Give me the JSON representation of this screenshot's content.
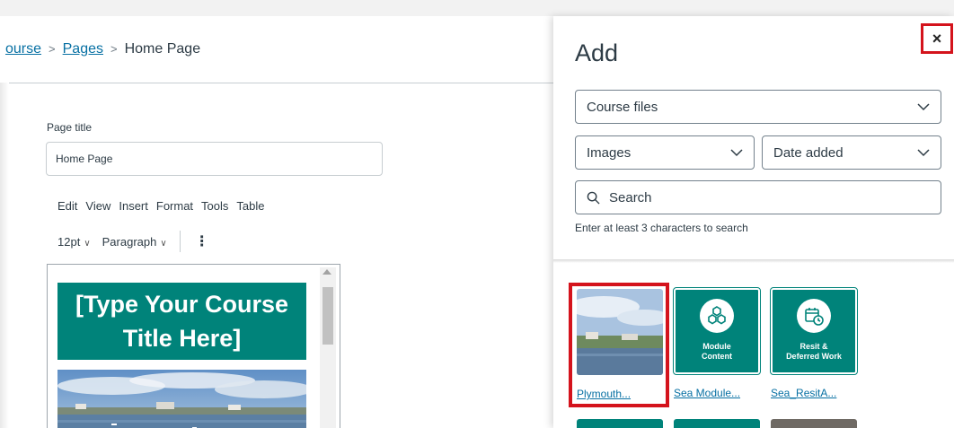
{
  "breadcrumb": [
    {
      "label": "ourse",
      "link": true
    },
    {
      "label": "Pages",
      "link": true
    },
    {
      "label": "Home Page",
      "link": false
    }
  ],
  "editor": {
    "page_title_label": "Page title",
    "page_title_value": "Home Page",
    "menu": [
      "Edit",
      "View",
      "Insert",
      "Format",
      "Tools",
      "Table"
    ],
    "font_size": "12pt",
    "block_format": "Paragraph",
    "banner_text_line1": "[Type Your Course",
    "banner_text_line2": "Title Here]"
  },
  "tray": {
    "title": "Add",
    "close_label": "×",
    "source_select": "Course files",
    "type_select": "Images",
    "sort_select": "Date added",
    "search_placeholder": "Search",
    "search_hint": "Enter at least 3 characters to search",
    "items": [
      {
        "caption": "Plymouth...",
        "kind": "photo",
        "selected": true
      },
      {
        "caption": "Sea Module...",
        "kind": "tile",
        "tile_label": "Module\nContent",
        "icon": "cubes-icon"
      },
      {
        "caption": "Sea_ResitA...",
        "kind": "tile",
        "tile_label": "Resit &\nDeferred Work",
        "icon": "calendar-clock-icon"
      }
    ]
  },
  "colors": {
    "accent_teal": "#00837a",
    "link_blue": "#0770a3",
    "highlight_red": "#d4131c"
  }
}
